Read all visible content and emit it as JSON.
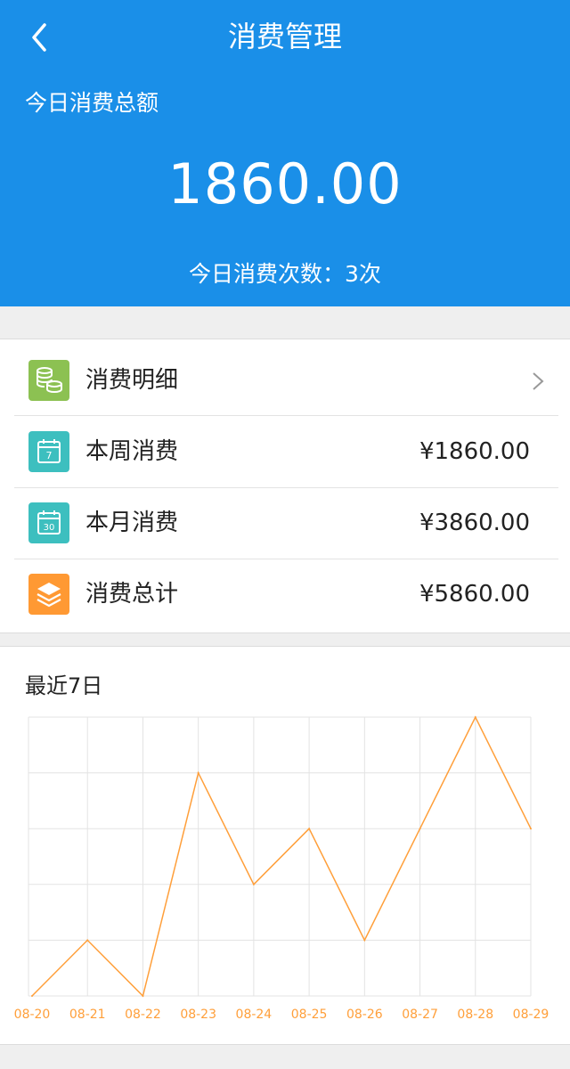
{
  "header": {
    "title": "消费管理",
    "back_icon": "chevron-left-icon"
  },
  "summary": {
    "label": "今日消费总额",
    "amount": "1860.00",
    "count_text": "今日消费次数：3次"
  },
  "menu": [
    {
      "label": "消费明细",
      "value": "",
      "icon": "coins-icon",
      "color": "#8cc152"
    },
    {
      "label": "本周消费",
      "value": "¥1860.00",
      "icon": "calendar-7-icon",
      "color": "#3dbfbf"
    },
    {
      "label": "本月消费",
      "value": "¥3860.00",
      "icon": "calendar-30-icon",
      "color": "#3dbfbf"
    },
    {
      "label": "消费总计",
      "value": "¥5860.00",
      "icon": "layers-icon",
      "color": "#ff9933"
    }
  ],
  "chart": {
    "title": "最近7日"
  },
  "colors": {
    "primary": "#1a8fe8",
    "line": "#ff9f3a",
    "grid": "#e3e3e3"
  },
  "chart_data": {
    "type": "line",
    "title": "最近7日",
    "x": [
      "08-20",
      "08-21",
      "08-22",
      "08-23",
      "08-24",
      "08-25",
      "08-26",
      "08-27",
      "08-28",
      "08-29"
    ],
    "values": [
      0,
      1,
      0,
      4,
      2,
      3,
      1,
      3,
      5,
      3
    ],
    "ylim": [
      0,
      5
    ],
    "grid": true,
    "show_y_labels": false
  }
}
